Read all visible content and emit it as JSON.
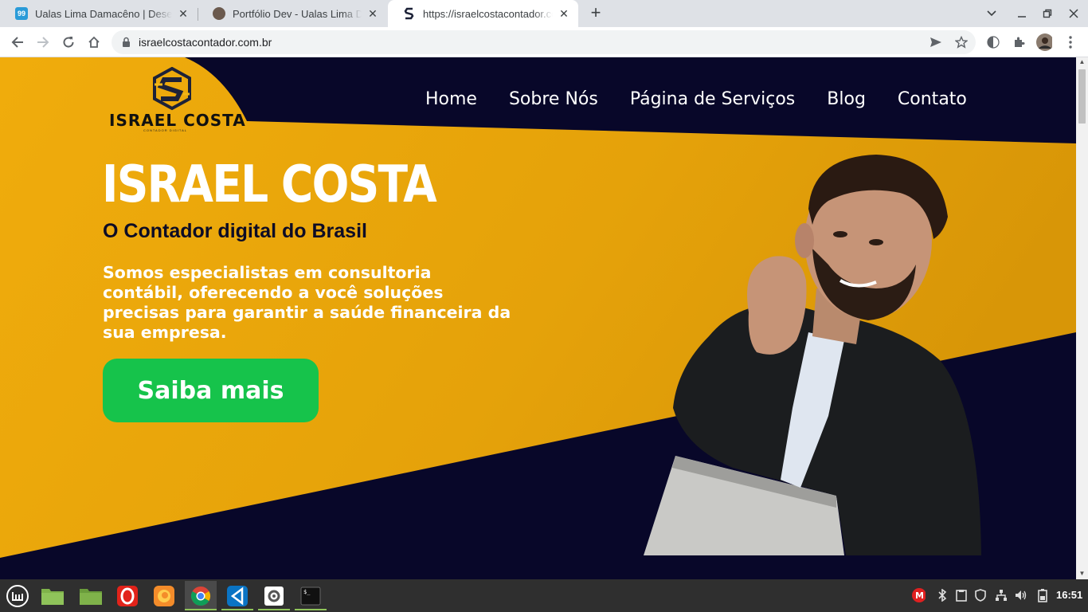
{
  "browser": {
    "tabs": [
      {
        "title": "Ualas Lima Damacêno | Desenvolvedor",
        "favicon": "99-badge-icon",
        "active": false
      },
      {
        "title": "Portfólio Dev - Ualas Lima Damacêno",
        "favicon": "avatar-icon",
        "active": false
      },
      {
        "title": "https://israelcostacontador.com.br",
        "favicon": "s-logo-icon",
        "active": true
      }
    ],
    "url": "israelcostacontador.com.br"
  },
  "site": {
    "logo_text": "ISRAEL COSTA",
    "logo_subtext": "CONTADOR DIGITAL",
    "nav": [
      "Home",
      "Sobre Nós",
      "Página de Serviços",
      "Blog",
      "Contato"
    ],
    "hero": {
      "title": "ISRAEL COSTA",
      "subtitle": "O Contador digital do Brasil",
      "description": "Somos especialistas em consultoria contábil, oferecendo a você soluções precisas para garantir a saúde financeira da sua empresa.",
      "cta": "Saiba mais"
    },
    "colors": {
      "navy": "#080729",
      "gold": "#e8a70c",
      "cta_green": "#16c34b"
    }
  },
  "taskbar": {
    "apps": [
      "mint-menu-icon",
      "folder-icon",
      "files-icon",
      "opera-icon",
      "firefox-icon",
      "chrome-icon",
      "vscode-icon",
      "settings-icon",
      "terminal-icon"
    ],
    "clock": "16:51"
  }
}
